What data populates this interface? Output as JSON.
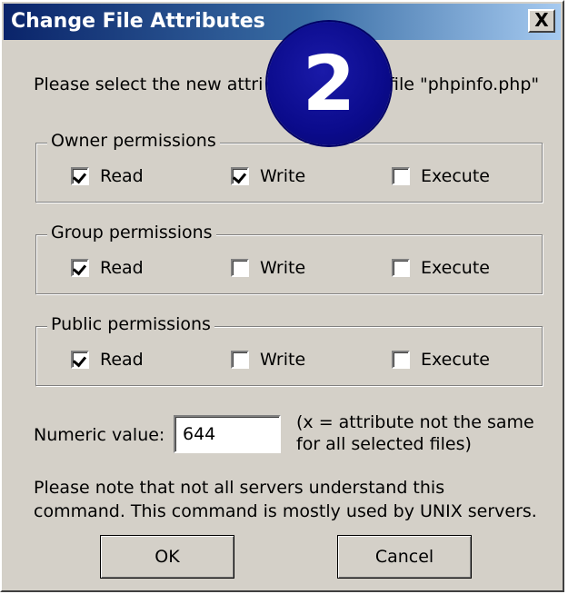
{
  "window": {
    "title": "Change File Attributes",
    "close_label": "X"
  },
  "instruction": {
    "left": "Please select the new attri",
    "right": "file \"phpinfo.php\""
  },
  "badge": {
    "number": "2",
    "color": "#0b0b8c"
  },
  "groups": [
    {
      "legend": "Owner permissions",
      "items": [
        {
          "label": "Read",
          "checked": true
        },
        {
          "label": "Write",
          "checked": true
        },
        {
          "label": "Execute",
          "checked": false
        }
      ]
    },
    {
      "legend": "Group permissions",
      "items": [
        {
          "label": "Read",
          "checked": true
        },
        {
          "label": "Write",
          "checked": false
        },
        {
          "label": "Execute",
          "checked": false
        }
      ]
    },
    {
      "legend": "Public permissions",
      "items": [
        {
          "label": "Read",
          "checked": true
        },
        {
          "label": "Write",
          "checked": false
        },
        {
          "label": "Execute",
          "checked": false
        }
      ]
    }
  ],
  "numeric": {
    "label": "Numeric value:",
    "value": "644",
    "hint_line1": "(x = attribute not the same",
    "hint_line2": "for all selected files)"
  },
  "note": {
    "line1": "Please note that not all servers understand this",
    "line2": "command. This command is mostly used by UNIX servers."
  },
  "buttons": {
    "ok": "OK",
    "cancel": "Cancel"
  },
  "colors": {
    "dialog_bg": "#d4d0c8",
    "title_start": "#0a246a",
    "title_end": "#a6caf0"
  }
}
